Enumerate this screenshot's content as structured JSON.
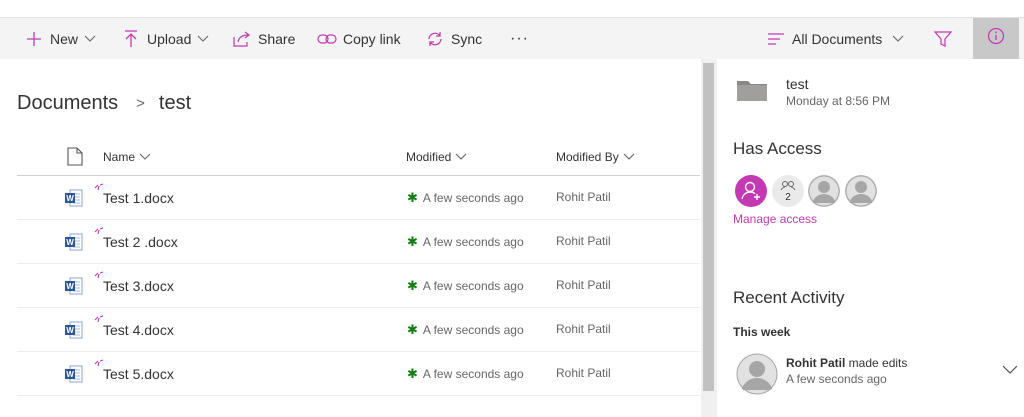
{
  "toolbar": {
    "new_label": "New",
    "upload_label": "Upload",
    "share_label": "Share",
    "copy_link_label": "Copy link",
    "sync_label": "Sync",
    "more_label": "···",
    "view_label": "All Documents",
    "icons": [
      "plus-icon",
      "upload-arrow-icon",
      "share-icon",
      "link-icon",
      "sync-icon",
      "lines-icon",
      "filter-icon",
      "info-icon"
    ],
    "accent_color": "#c239b3"
  },
  "breadcrumb": {
    "root": "Documents",
    "separator": ">",
    "current": "test"
  },
  "columns": {
    "name": "Name",
    "modified": "Modified",
    "modified_by": "Modified By"
  },
  "files": [
    {
      "name": "Test 1.docx",
      "modified": "A few seconds ago",
      "modified_by": "Rohit Patil"
    },
    {
      "name": "Test 2 .docx",
      "modified": "A few seconds ago",
      "modified_by": "Rohit Patil"
    },
    {
      "name": "Test 3.docx",
      "modified": "A few seconds ago",
      "modified_by": "Rohit Patil"
    },
    {
      "name": "Test 4.docx",
      "modified": "A few seconds ago",
      "modified_by": "Rohit Patil"
    },
    {
      "name": "Test 5.docx",
      "modified": "A few seconds ago",
      "modified_by": "Rohit Patil"
    }
  ],
  "details": {
    "folder_name": "test",
    "folder_date": "Monday at 8:56 PM",
    "has_access_title": "Has Access",
    "group_count": "2",
    "manage_access": "Manage access",
    "recent_activity_title": "Recent Activity",
    "period": "This week",
    "activity": {
      "user": "Rohit Patil",
      "action": " made edits",
      "time": "A few seconds ago"
    }
  }
}
